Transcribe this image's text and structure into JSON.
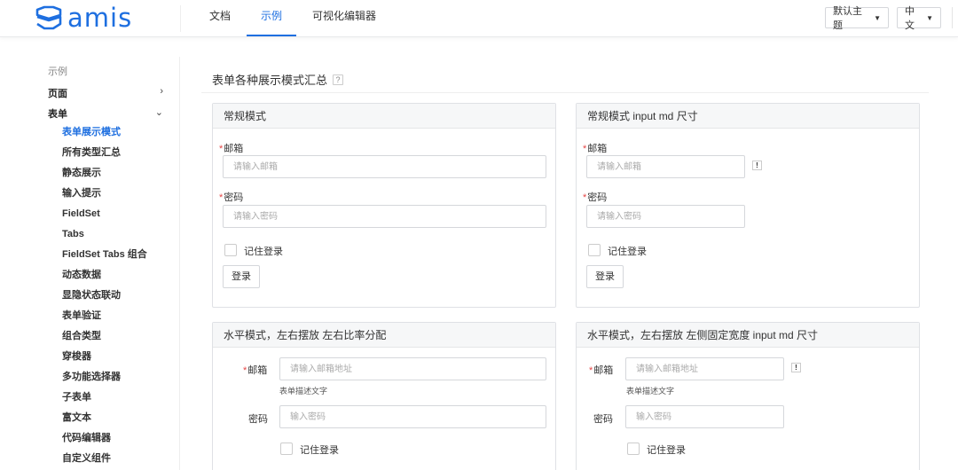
{
  "header": {
    "logo_text": "amis",
    "nav": [
      {
        "label": "文档"
      },
      {
        "label": "示例"
      },
      {
        "label": "可视化编辑器"
      }
    ],
    "theme_select": "默认主题",
    "lang_select": "中文",
    "accent_color": "#1e6fe0"
  },
  "sidebar": {
    "title": "示例",
    "groups": [
      {
        "label": "页面",
        "icon": "chevron-right-icon"
      },
      {
        "label": "表单",
        "icon": "chevron-down-icon"
      }
    ],
    "items": [
      {
        "label": "表单展示模式"
      },
      {
        "label": "所有类型汇总"
      },
      {
        "label": "静态展示"
      },
      {
        "label": "输入提示"
      },
      {
        "label": "FieldSet"
      },
      {
        "label": "Tabs"
      },
      {
        "label": "FieldSet Tabs 组合"
      },
      {
        "label": "动态数据"
      },
      {
        "label": "显隐状态联动"
      },
      {
        "label": "表单验证"
      },
      {
        "label": "组合类型"
      },
      {
        "label": "穿梭器"
      },
      {
        "label": "多功能选择器"
      },
      {
        "label": "子表单"
      },
      {
        "label": "富文本"
      },
      {
        "label": "代码编辑器"
      },
      {
        "label": "自定义组件"
      }
    ]
  },
  "main": {
    "title": "表单各种展示模式汇总",
    "help": "?",
    "panels": [
      {
        "title": "常规模式",
        "email_label": "邮箱",
        "email_placeholder": "请输入邮箱",
        "password_label": "密码",
        "password_placeholder": "请输入密码",
        "remember_label": "记住登录",
        "submit_label": "登录"
      },
      {
        "title": "常规模式 input md 尺寸",
        "email_label": "邮箱",
        "email_placeholder": "请输入邮箱",
        "warn": "!",
        "password_label": "密码",
        "password_placeholder": "请输入密码",
        "remember_label": "记住登录",
        "submit_label": "登录"
      },
      {
        "title": "水平模式，左右摆放 左右比率分配",
        "email_label": "邮箱",
        "email_placeholder": "请输入邮箱地址",
        "email_desc": "表单描述文字",
        "password_label": "密码",
        "password_placeholder": "输入密码",
        "remember_label": "记住登录"
      },
      {
        "title": "水平模式，左右摆放 左侧固定宽度 input md 尺寸",
        "email_label": "邮箱",
        "email_placeholder": "请输入邮箱地址",
        "email_desc": "表单描述文字",
        "warn": "!",
        "password_label": "密码",
        "password_placeholder": "输入密码",
        "remember_label": "记住登录"
      }
    ]
  }
}
